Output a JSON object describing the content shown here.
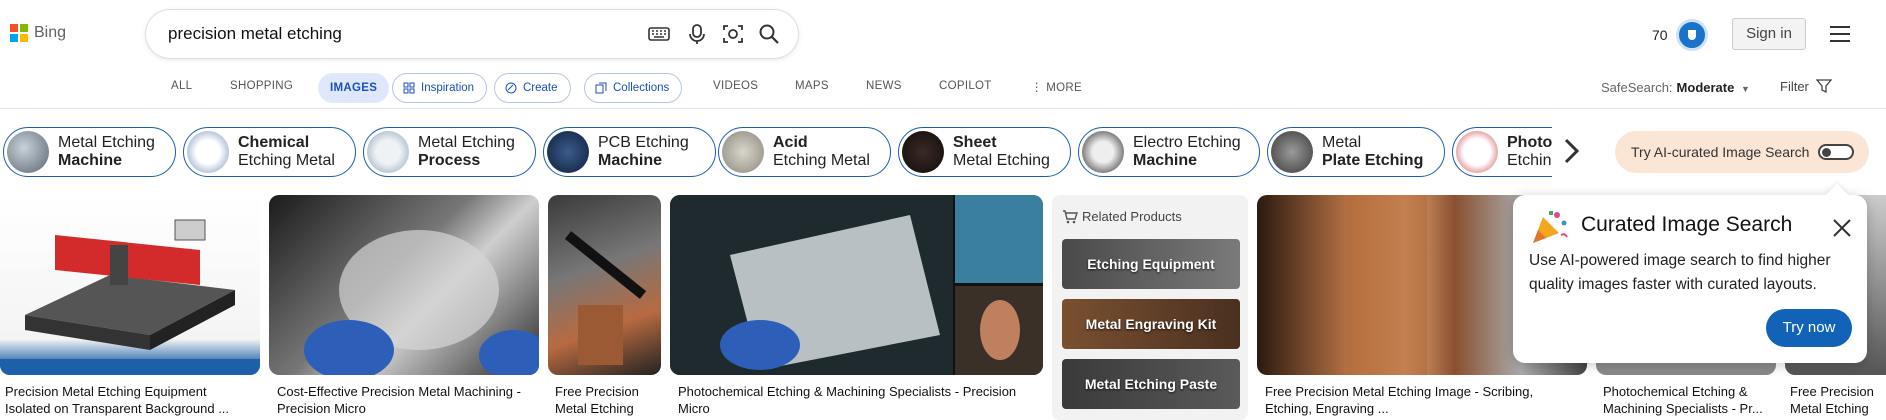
{
  "header": {
    "brand": "Bing",
    "query": "precision metal etching",
    "rewards_count": "70",
    "signin_label": "Sign in"
  },
  "nav": {
    "tabs": [
      "ALL",
      "SHOPPING",
      "IMAGES",
      "Inspiration",
      "Create",
      "Collections",
      "VIDEOS",
      "MAPS",
      "NEWS",
      "COPILOT",
      "MORE"
    ],
    "safesearch_label": "SafeSearch:",
    "safesearch_value": "Moderate",
    "filter_label": "Filter"
  },
  "related_searches": [
    {
      "line1": "Metal Etching",
      "line2": "Machine"
    },
    {
      "line1": "Chemical",
      "line2": "Etching Metal"
    },
    {
      "line1": "Metal Etching",
      "line2": "Process"
    },
    {
      "line1": "PCB Etching",
      "line2": "Machine"
    },
    {
      "line1": "Acid",
      "line2": "Etching Metal"
    },
    {
      "line1": "Sheet",
      "line2": "Metal Etching"
    },
    {
      "line1": "Electro Etching",
      "line2": "Machine"
    },
    {
      "line1": "Metal",
      "line2": "Plate Etching"
    },
    {
      "line1": "Photo",
      "line2": "Etching"
    }
  ],
  "ai_toggle_label": "Try AI-curated Image Search",
  "results": [
    {
      "caption": "Precision Metal Etching Equipment Isolated on Transparent Background ..."
    },
    {
      "caption": "Cost-Effective Precision Metal Machining - Precision Micro"
    },
    {
      "caption": "Free Precision Metal Etching"
    },
    {
      "caption": "Photochemical Etching & Machining Specialists - Precision Micro"
    },
    {
      "caption": "Free Precision Metal Etching Image - Scribing, Etching, Engraving ..."
    },
    {
      "caption": "Photochemical Etching & Machining Specialists - Pr..."
    },
    {
      "caption": "Free Precision Metal Etching"
    }
  ],
  "related_products": {
    "heading": "Related Products",
    "items": [
      "Etching Equipment",
      "Metal Engraving Kit",
      "Metal Etching Paste"
    ]
  },
  "popup": {
    "title": "Curated Image Search",
    "body": "Use AI-powered image search to find higher quality images faster with curated layouts.",
    "button": "Try now"
  }
}
